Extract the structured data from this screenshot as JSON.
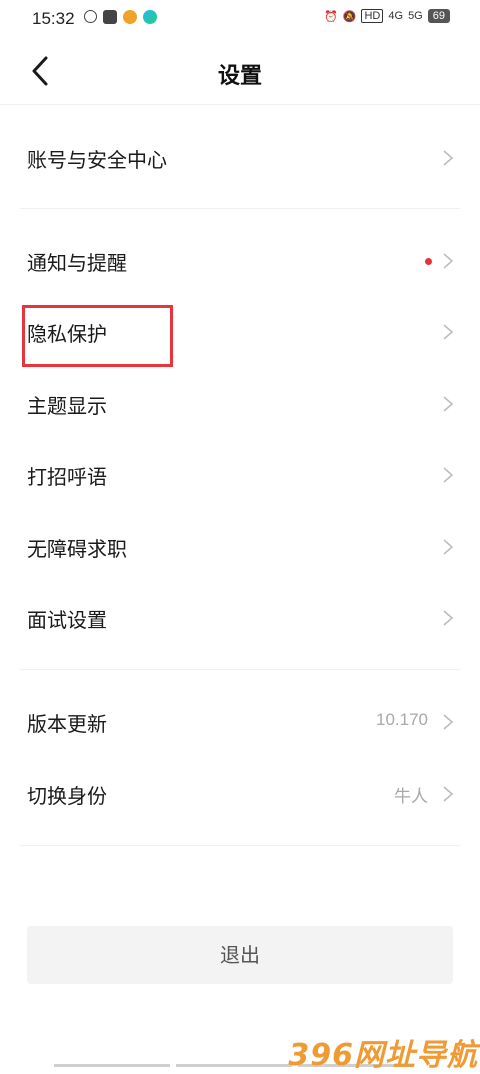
{
  "status_bar": {
    "time": "15:32",
    "network_4g": "4G",
    "network_5g": "5G",
    "battery": "69",
    "hd": "HD"
  },
  "header": {
    "title": "设置"
  },
  "menu": {
    "account_security": "账号与安全中心",
    "notifications": "通知与提醒",
    "privacy": "隐私保护",
    "theme_display": "主题显示",
    "greeting": "打招呼语",
    "accessibility_job": "无障碍求职",
    "interview_settings": "面试设置",
    "version_update": "版本更新",
    "version_value": "10.170",
    "switch_identity": "切换身份",
    "identity_value": "牛人"
  },
  "logout": {
    "label": "退出"
  },
  "watermark": "396网址导航",
  "colors": {
    "highlight": "#e8353c",
    "notification_dot": "#e63335",
    "watermark": "#f09a34"
  }
}
